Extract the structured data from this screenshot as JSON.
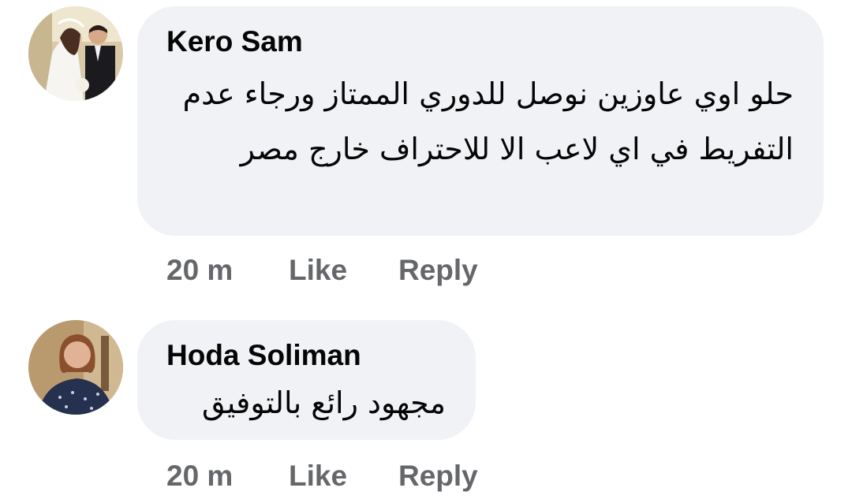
{
  "comments": [
    {
      "author": "Kero Sam",
      "text": "حلو اوي عاوزين نوصل للدوري الممتاز ورجاء عدم التفريط في اي لاعب الا للاحتراف خارج مصر",
      "time": "20 m",
      "like_label": "Like",
      "reply_label": "Reply",
      "avatar_icon": "wedding-couple-photo"
    },
    {
      "author": "Hoda Soliman",
      "text": "مجهود رائع بالتوفيق",
      "time": "20 m",
      "like_label": "Like",
      "reply_label": "Reply",
      "avatar_icon": "woman-portrait-photo"
    }
  ],
  "colors": {
    "bubble_background": "#f0f2f5",
    "author_text": "#050505",
    "action_text": "#65676b"
  }
}
